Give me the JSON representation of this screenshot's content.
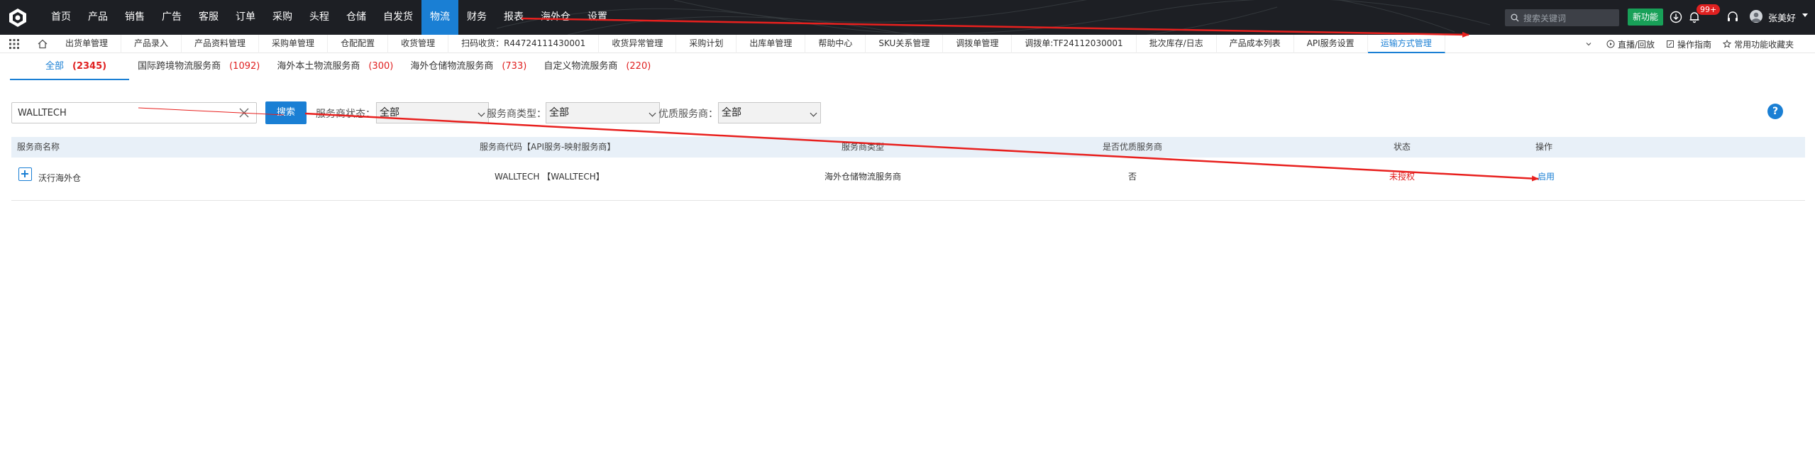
{
  "topnav": {
    "items": [
      "首页",
      "产品",
      "销售",
      "广告",
      "客服",
      "订单",
      "采购",
      "头程",
      "仓储",
      "自发货",
      "物流",
      "财务",
      "报表",
      "海外仓",
      "设置"
    ],
    "active": "物流",
    "search_placeholder": "搜索关键词",
    "new_feature": "新功能",
    "notif_badge": "99+",
    "username": "张美好"
  },
  "tabs": {
    "items": [
      "出货单管理",
      "产品录入",
      "产品资料管理",
      "采购单管理",
      "仓配配置",
      "收货管理",
      "扫码收货：R44724111430001",
      "收货异常管理",
      "采购计划",
      "出库单管理",
      "帮助中心",
      "SKU关系管理",
      "调拨单管理",
      "调拨单:TF24112030001",
      "批次库存/日志",
      "产品成本列表",
      "API服务设置",
      "运输方式管理"
    ],
    "active": "运输方式管理",
    "right_live": "直播/回放",
    "right_guide": "操作指南",
    "right_fav": "常用功能收藏夹"
  },
  "category_tabs": [
    {
      "label": "全部",
      "count": "(2345)"
    },
    {
      "label": "国际跨境物流服务商",
      "count": "(1092)"
    },
    {
      "label": "海外本土物流服务商",
      "count": "(300)"
    },
    {
      "label": "海外仓储物流服务商",
      "count": "(733)"
    },
    {
      "label": "自定义物流服务商",
      "count": "(220)"
    }
  ],
  "filter": {
    "keyword_value": "WALLTECH",
    "search_label": "搜索",
    "status_label": "服务商状态：",
    "status_value": "全部",
    "type_label": "服务商类型：",
    "type_value": "全部",
    "quality_label": "优质服务商：",
    "quality_value": "全部",
    "help": "?"
  },
  "table": {
    "headers": [
      "服务商名称",
      "服务商代码【API服务-映射服务商】",
      "服务商类型",
      "是否优质服务商",
      "状态",
      "操作"
    ],
    "rows": [
      {
        "name": "沃行海外仓",
        "code": "WALLTECH 【WALLTECH】",
        "type": "海外仓储物流服务商",
        "quality": "否",
        "status": "未授权",
        "action": "启用"
      }
    ]
  },
  "colors": {
    "brand": "#1a7fd4",
    "topbar": "#1d1f24",
    "danger": "#e02020",
    "success": "#18a058",
    "annotation": "#e8201e"
  }
}
